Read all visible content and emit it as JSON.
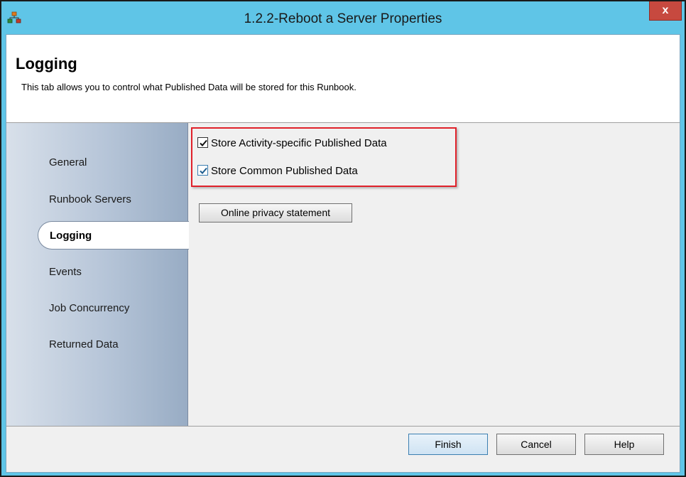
{
  "window": {
    "title": "1.2.2-Reboot a Server Properties",
    "close_label": "x",
    "colors": {
      "titlebar": "#5fc5e7",
      "close": "#c7493f",
      "highlight": "#e0212a",
      "check_accent": "#3c7fb1"
    }
  },
  "header": {
    "title": "Logging",
    "description": "This tab allows you to control what Published Data will be stored for this Runbook."
  },
  "sidebar": {
    "items": [
      {
        "label": "General",
        "active": false
      },
      {
        "label": "Runbook Servers",
        "active": false
      },
      {
        "label": "Logging",
        "active": true
      },
      {
        "label": "Events",
        "active": false
      },
      {
        "label": "Job Concurrency",
        "active": false
      },
      {
        "label": "Returned Data",
        "active": false
      }
    ]
  },
  "content": {
    "options": [
      {
        "label": "Store Activity-specific Published Data",
        "checked": true
      },
      {
        "label": "Store Common Published Data",
        "checked": true
      }
    ],
    "privacy_button": "Online privacy statement"
  },
  "footer": {
    "finish": "Finish",
    "cancel": "Cancel",
    "help": "Help"
  }
}
